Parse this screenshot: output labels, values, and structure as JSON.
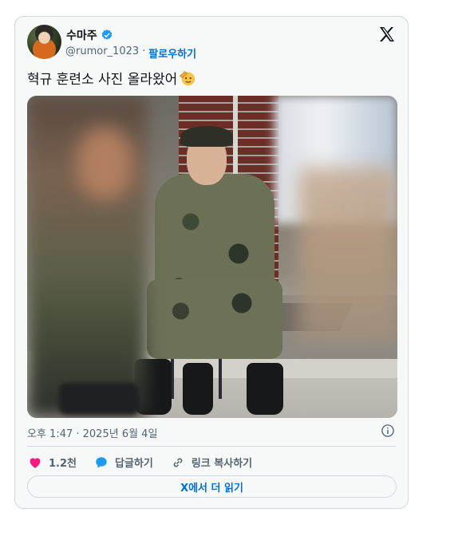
{
  "tweet": {
    "author_name": "수마주",
    "handle": "@rumor_1023",
    "separator": "·",
    "follow_label": "팔로우하기",
    "text": "혁규 훈련소 사진 올라왔어",
    "timestamp": "오후 1:47 · 2025년 6월 4일",
    "likes": "1.2천",
    "reply_label": "답글하기",
    "copy_link_label": "링크 복사하기",
    "read_more_label": "X에서 더 읽기"
  },
  "icons": {
    "verified": "verified-badge-icon",
    "x_logo": "x-logo-icon",
    "emoji": "saluting-face-emoji",
    "info": "info-icon",
    "like": "heart-icon",
    "reply": "speech-bubble-icon",
    "link": "link-icon"
  },
  "colors": {
    "accent": "#1d9bf0",
    "link": "#006fd6",
    "like": "#f91880",
    "muted": "#536471"
  }
}
